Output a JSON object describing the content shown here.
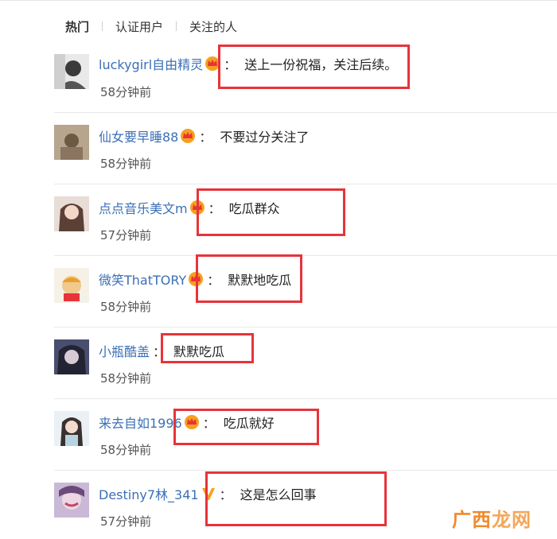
{
  "tabs": [
    {
      "label": "热门",
      "active": true
    },
    {
      "label": "认证用户",
      "active": false
    },
    {
      "label": "关注的人",
      "active": false
    }
  ],
  "comments": [
    {
      "user": "luckygirl自由精灵",
      "badge": "crown-icon",
      "text": "送上一份祝福，关注后续。",
      "time": "58分钟前"
    },
    {
      "user": "仙女要早睡88",
      "badge": "crown-icon",
      "text": "不要过分关注了",
      "time": "58分钟前"
    },
    {
      "user": "点点音乐美文m",
      "badge": "crown-icon",
      "text": "吃瓜群众",
      "time": "57分钟前"
    },
    {
      "user": "微笑ThatTORY",
      "badge": "crown-icon",
      "text": "默默地吃瓜",
      "time": "58分钟前"
    },
    {
      "user": "小瓶酷盖",
      "badge": "",
      "text": "默默吃瓜",
      "time": "58分钟前"
    },
    {
      "user": "来去自如1996",
      "badge": "crown-icon",
      "text": "吃瓜就好",
      "time": "58分钟前"
    },
    {
      "user": "Destiny7林_341",
      "badge": "verified-v-icon",
      "text": "这是怎么回事",
      "time": "57分钟前"
    }
  ],
  "colon": "：",
  "watermark": {
    "part1": "广西",
    "part2": "龙网"
  },
  "colors": {
    "username": "#3b6fb6",
    "highlight": "#e8333a",
    "watermark": "#f08a2c"
  }
}
